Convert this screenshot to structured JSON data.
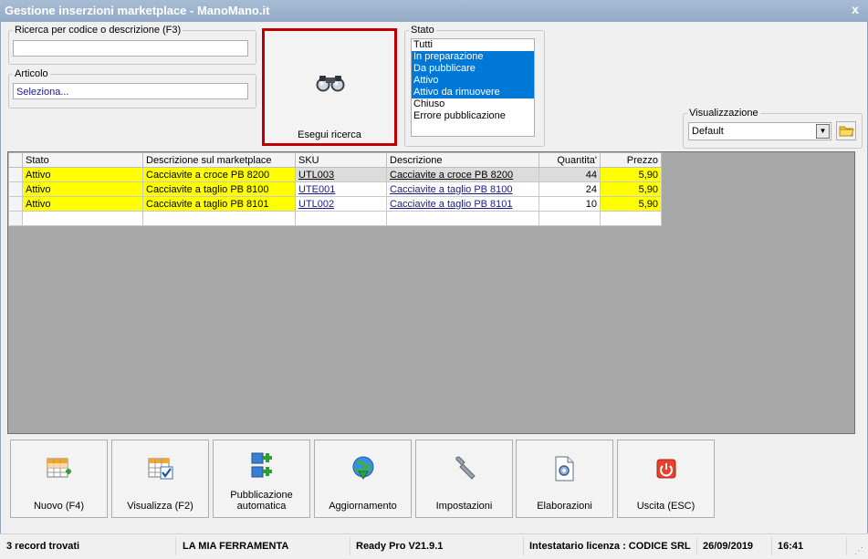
{
  "window": {
    "title": "Gestione inserzioni marketplace - ManoMano.it",
    "close_label": "x"
  },
  "search": {
    "legend": "Ricerca per codice o descrizione (F3)",
    "value": ""
  },
  "articolo": {
    "legend": "Articolo",
    "value": "Seleziona..."
  },
  "search_button": {
    "label": "Esegui ricerca",
    "icon": "binoculars-icon"
  },
  "stato": {
    "legend": "Stato",
    "options": [
      {
        "label": "Tutti",
        "selected": false
      },
      {
        "label": "In preparazione",
        "selected": true
      },
      {
        "label": "Da pubblicare",
        "selected": true
      },
      {
        "label": "Attivo",
        "selected": true
      },
      {
        "label": "Attivo da rimuovere",
        "selected": true
      },
      {
        "label": "Chiuso",
        "selected": false
      },
      {
        "label": "Errore pubblicazione",
        "selected": false
      }
    ]
  },
  "visualizzazione": {
    "legend": "Visualizzazione",
    "value": "Default"
  },
  "grid": {
    "columns": [
      "Stato",
      "Descrizione sul marketplace",
      "SKU",
      "Descrizione",
      "Quantita'",
      "Prezzo"
    ],
    "rows": [
      {
        "stato": "Attivo",
        "desc_mp": "Cacciavite a croce PB 8200",
        "sku": "UTL003",
        "descrizione": "Cacciavite a croce PB 8200",
        "qty": "44",
        "prezzo": "5,90"
      },
      {
        "stato": "Attivo",
        "desc_mp": "Cacciavite a taglio PB 8100",
        "sku": "UTE001",
        "descrizione": "Cacciavite a taglio PB 8100",
        "qty": "24",
        "prezzo": "5,90"
      },
      {
        "stato": "Attivo",
        "desc_mp": "Cacciavite a taglio PB 8101",
        "sku": "UTL002",
        "descrizione": "Cacciavite a taglio PB 8101",
        "qty": "10",
        "prezzo": "5,90"
      }
    ],
    "highlight_color": "#ffff00",
    "selected_row_color": "#dcdcdc"
  },
  "toolbar": [
    {
      "label": "Nuovo (F4)",
      "icon": "new-grid-icon"
    },
    {
      "label": "Visualizza (F2)",
      "icon": "view-grid-icon"
    },
    {
      "label": "Pubblicazione automatica",
      "icon": "auto-publish-icon"
    },
    {
      "label": "Aggiornamento",
      "icon": "globe-download-icon"
    },
    {
      "label": "Impostazioni",
      "icon": "wrench-icon"
    },
    {
      "label": "Elaborazioni",
      "icon": "document-gear-icon"
    },
    {
      "label": "Uscita (ESC)",
      "icon": "power-icon"
    }
  ],
  "status": {
    "records": "3 record trovati",
    "company": "LA MIA FERRAMENTA",
    "version": "Ready Pro V21.9.1",
    "license": "Intestatario licenza : CODICE SRL",
    "date": "26/09/2019",
    "time": "16:41"
  }
}
